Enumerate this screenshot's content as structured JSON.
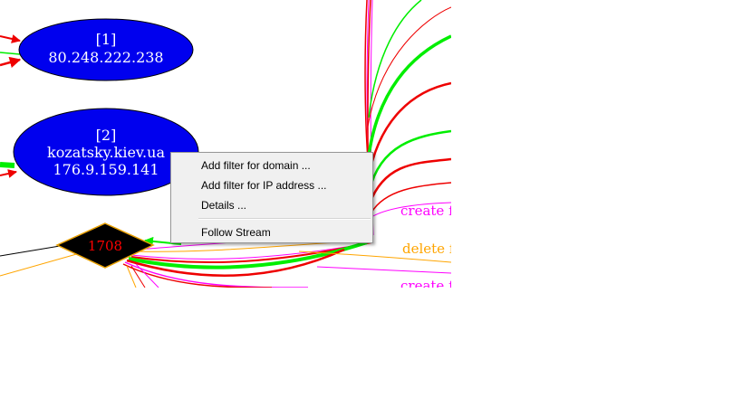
{
  "graph": {
    "nodes": [
      {
        "id": "node-1",
        "lines": [
          "[1]",
          "80.248.222.238"
        ],
        "fill": "#0000ee",
        "text_color": "#ffffff",
        "shape": "ellipse"
      },
      {
        "id": "node-2",
        "lines": [
          "[2]",
          "kozatsky.kiev.ua",
          "176.9.159.141"
        ],
        "fill": "#0000ee",
        "text_color": "#ffffff",
        "shape": "ellipse"
      },
      {
        "id": "node-1708",
        "label": "1708",
        "fill": "#000000",
        "stroke": "#e8a000",
        "text_color": "#ff0000",
        "shape": "diamond"
      }
    ],
    "edge_labels": [
      {
        "text": "create f",
        "color": "#ff00ff"
      },
      {
        "text": "delete f",
        "color": "#ffa500"
      },
      {
        "text": "create f",
        "color": "#ff00ff"
      }
    ],
    "colors": {
      "red": "#ee0000",
      "green": "#00ee00",
      "magenta": "#ff00ff",
      "orange": "#ffa500",
      "black": "#000000"
    }
  },
  "context_menu": {
    "items": [
      "Add filter for domain ...",
      "Add filter for IP address ...",
      "Details ...",
      "Follow Stream"
    ]
  }
}
